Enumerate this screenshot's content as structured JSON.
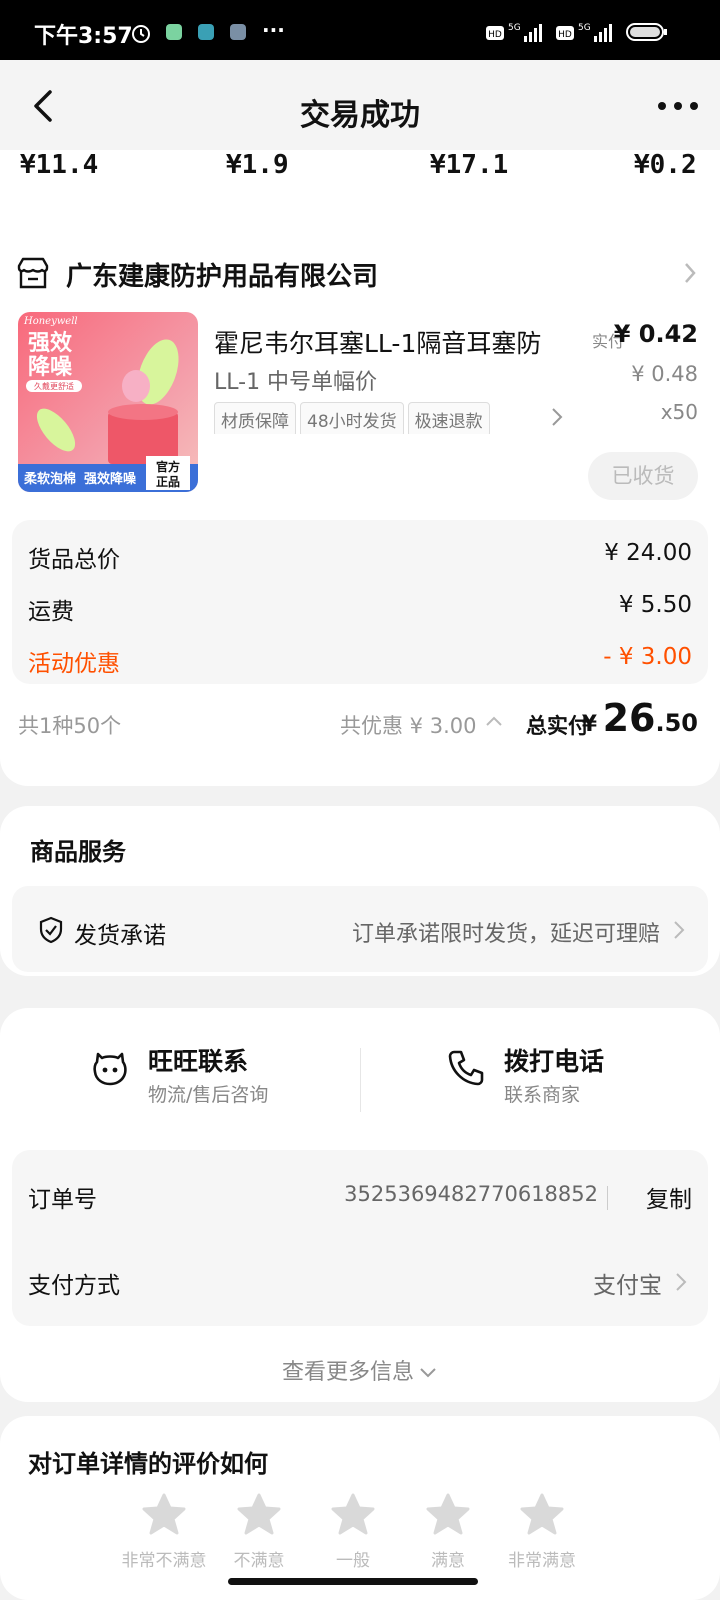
{
  "status_bar": {
    "time": "下午3:57",
    "dots": "···"
  },
  "header": {
    "title": "交易成功"
  },
  "price_strip": [
    "¥11.4",
    "¥1.9",
    "¥17.1",
    "¥0.2"
  ],
  "shop": {
    "name": "广东建康防护用品有限公司"
  },
  "product": {
    "title": "霍尼韦尔耳塞LL-1隔音耳塞防",
    "spec": "LL-1 中号单幅价",
    "tags": [
      "材质保障",
      "48小时发货",
      "极速退款"
    ],
    "paid_label": "实付",
    "paid_price": "¥ 0.42",
    "original_price": "¥ 0.48",
    "quantity": "x50",
    "status_button": "已收货",
    "image": {
      "brand": "Honeywell",
      "headline1": "强效",
      "headline2": "降噪",
      "sub": "久戴更舒适",
      "bottom1": "柔软泡棉",
      "bottom2": "强效降噪",
      "badge1": "官方",
      "badge2": "正品"
    }
  },
  "summary": {
    "goods_total_label": "货品总价",
    "goods_total": "¥ 24.00",
    "shipping_label": "运费",
    "shipping": "¥ 5.50",
    "discount_label": "活动优惠",
    "discount": "- ¥ 3.00"
  },
  "footer": {
    "count": "共1种50个",
    "total_discount": "共优惠 ¥ 3.00",
    "total_label": "总实付",
    "currency": "¥",
    "total_int": "26",
    "total_dec": ".50"
  },
  "service": {
    "section_title": "商品服务",
    "item_label": "发货承诺",
    "item_desc": "订单承诺限时发货，延迟可理赔"
  },
  "contacts": {
    "wangwang_title": "旺旺联系",
    "wangwang_sub": "物流/售后咨询",
    "phone_title": "拨打电话",
    "phone_sub": "联系商家"
  },
  "details": {
    "order_no_label": "订单号",
    "order_no": "3525369482770618852",
    "copy_label": "复制",
    "payment_label": "支付方式",
    "payment_value": "支付宝",
    "more_info": "查看更多信息"
  },
  "rating": {
    "question": "对订单详情的评价如何",
    "options": [
      "非常不满意",
      "不满意",
      "一般",
      "满意",
      "非常满意"
    ]
  },
  "colors": {
    "accent": "#ff5000",
    "background": "#f2f2f2",
    "card": "#ffffff"
  }
}
